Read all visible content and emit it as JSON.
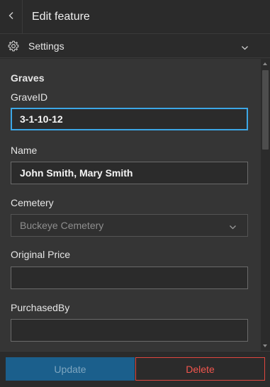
{
  "header": {
    "title": "Edit feature",
    "back_icon": "chevron-left-icon"
  },
  "settings": {
    "label": "Settings",
    "icon": "gear-icon",
    "expand_icon": "chevron-down-icon"
  },
  "form": {
    "group_title": "Graves",
    "fields": {
      "graveid": {
        "label": "GraveID",
        "value": "3-1-10-12"
      },
      "name": {
        "label": "Name",
        "value": "John Smith, Mary Smith"
      },
      "cemetery": {
        "label": "Cemetery",
        "value": "Buckeye Cemetery"
      },
      "original_price": {
        "label": "Original Price",
        "value": ""
      },
      "purchased_by": {
        "label": "PurchasedBy",
        "value": ""
      }
    }
  },
  "footer": {
    "update_label": "Update",
    "delete_label": "Delete"
  },
  "colors": {
    "focus": "#3ca7e6",
    "primary": "#1b5f8c",
    "danger": "#e0473f"
  }
}
